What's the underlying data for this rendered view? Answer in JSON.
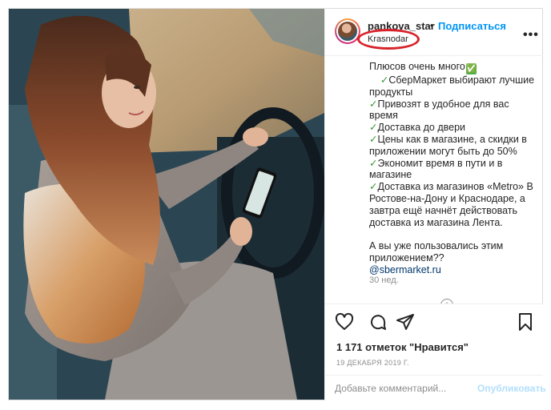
{
  "post": {
    "username": "pankova_star",
    "separator": "•",
    "follow_label": "Подписаться",
    "location": "Krasnodar",
    "more_icon": "more-horizontal-icon"
  },
  "caption": {
    "lines": [
      {
        "text": "Плюсов очень много",
        "check_box": "✅"
      },
      {
        "prefix": "    ✓",
        "text": "СберМаркет выбирают лучшие"
      },
      {
        "text": "продукты"
      },
      {
        "prefix": "✓",
        "text": "Привозят в удобное для вас время"
      },
      {
        "prefix": "✓",
        "text": "Доставка до двери"
      },
      {
        "prefix": "✓",
        "text": "Цены как в магазине, а скидки в"
      },
      {
        "text": "приложении могут быть до 50%"
      },
      {
        "prefix": "✓",
        "text": "Экономит время в пути и в"
      },
      {
        "text": "магазине"
      },
      {
        "prefix": "✓",
        "text": "Доставка из магазинов «Metro» В"
      },
      {
        "text": "Ростове-на-Дону и Краснодаре, а"
      },
      {
        "text": "завтра ещё начнёт действовать"
      },
      {
        "text": "доставка из магазина Лента."
      },
      {
        "text": ""
      },
      {
        "text": "А вы уже пользовались этим"
      },
      {
        "text": "приложением??"
      }
    ],
    "mention": "@sbermarket.ru",
    "time_ago": "30 нед."
  },
  "actions": {
    "like_icon": "heart-icon",
    "comment_icon": "comment-icon",
    "share_icon": "share-icon",
    "save_icon": "bookmark-icon",
    "likes_text": "1 171 отметок \"Нравится\"",
    "date": "19 ДЕКАБРЯ 2019 Г."
  },
  "comment": {
    "placeholder": "Добавьте комментарий...",
    "publish_label": "Опубликовать"
  },
  "colors": {
    "accent": "#0095f6",
    "publish_disabled": "#b2dffc",
    "location_highlight": "#d8232a",
    "check_green": "#4cb04c"
  }
}
